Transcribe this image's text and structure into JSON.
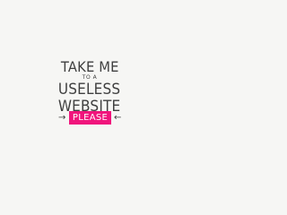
{
  "logo": {
    "line1": "TAKE ME",
    "line2": "TO A",
    "line3": "USELESS",
    "line4": "WEBSITE"
  },
  "cta": {
    "label": "PLEASE",
    "left_arrow_glyph": "→",
    "right_arrow_glyph": "←"
  },
  "colors": {
    "background": "#f6f6f4",
    "text": "#3f3f3f",
    "accent": "#f0157c"
  },
  "icons": {
    "left": "arrow-right-icon",
    "right": "arrow-left-icon"
  }
}
